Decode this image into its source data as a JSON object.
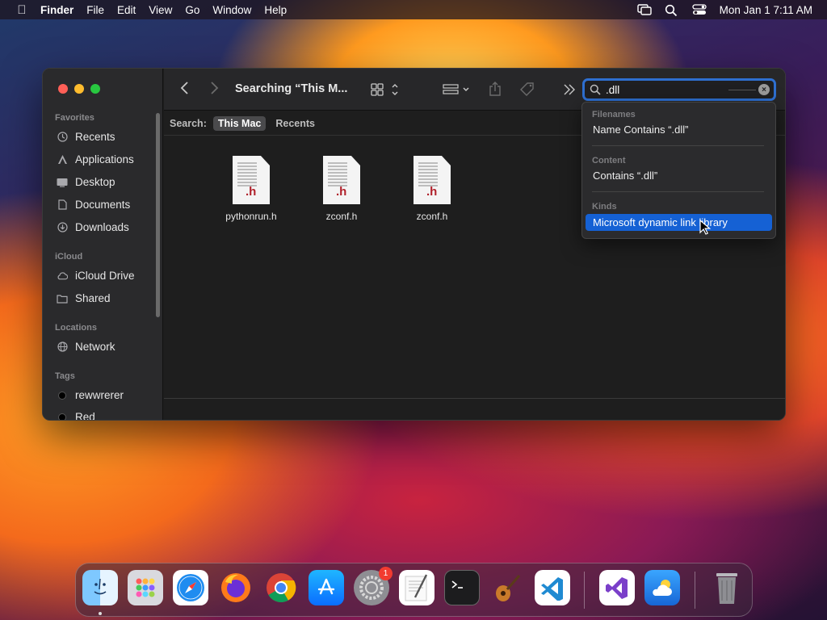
{
  "menubar": {
    "app_name": "Finder",
    "items": [
      "File",
      "Edit",
      "View",
      "Go",
      "Window",
      "Help"
    ],
    "clock": "Mon Jan 1  7:11 AM"
  },
  "sidebar": {
    "favorites_label": "Favorites",
    "favorites": [
      {
        "label": "Recents",
        "icon": "clock-icon"
      },
      {
        "label": "Applications",
        "icon": "applications-icon"
      },
      {
        "label": "Desktop",
        "icon": "desktop-icon"
      },
      {
        "label": "Documents",
        "icon": "document-icon"
      },
      {
        "label": "Downloads",
        "icon": "download-icon"
      }
    ],
    "icloud_label": "iCloud",
    "icloud": [
      {
        "label": "iCloud Drive",
        "icon": "cloud-icon"
      },
      {
        "label": "Shared",
        "icon": "shared-folder-icon"
      }
    ],
    "locations_label": "Locations",
    "locations": [
      {
        "label": "Network",
        "icon": "network-icon"
      }
    ],
    "tags_label": "Tags",
    "tags": [
      {
        "label": "rewwrerer"
      },
      {
        "label": "Red"
      }
    ]
  },
  "toolbar": {
    "title": "Searching “This M...",
    "search_value": ".dll"
  },
  "scopebar": {
    "label": "Search:",
    "scopes": [
      "This Mac",
      "Recents"
    ],
    "active": "This Mac"
  },
  "files": [
    {
      "name": "pythonrun.h",
      "ext": ".h"
    },
    {
      "name": "zconf.h",
      "ext": ".h"
    },
    {
      "name": "zconf.h",
      "ext": ".h"
    }
  ],
  "suggestions": {
    "filenames_header": "Filenames",
    "filenames_item": "Name Contains “.dll”",
    "content_header": "Content",
    "content_item": "Contains “.dll”",
    "kinds_header": "Kinds",
    "kinds_item": "Microsoft dynamic link library"
  },
  "dock": {
    "settings_badge": "1"
  },
  "colors": {
    "accent": "#1561d4",
    "search_focus": "#2e6fd0"
  }
}
